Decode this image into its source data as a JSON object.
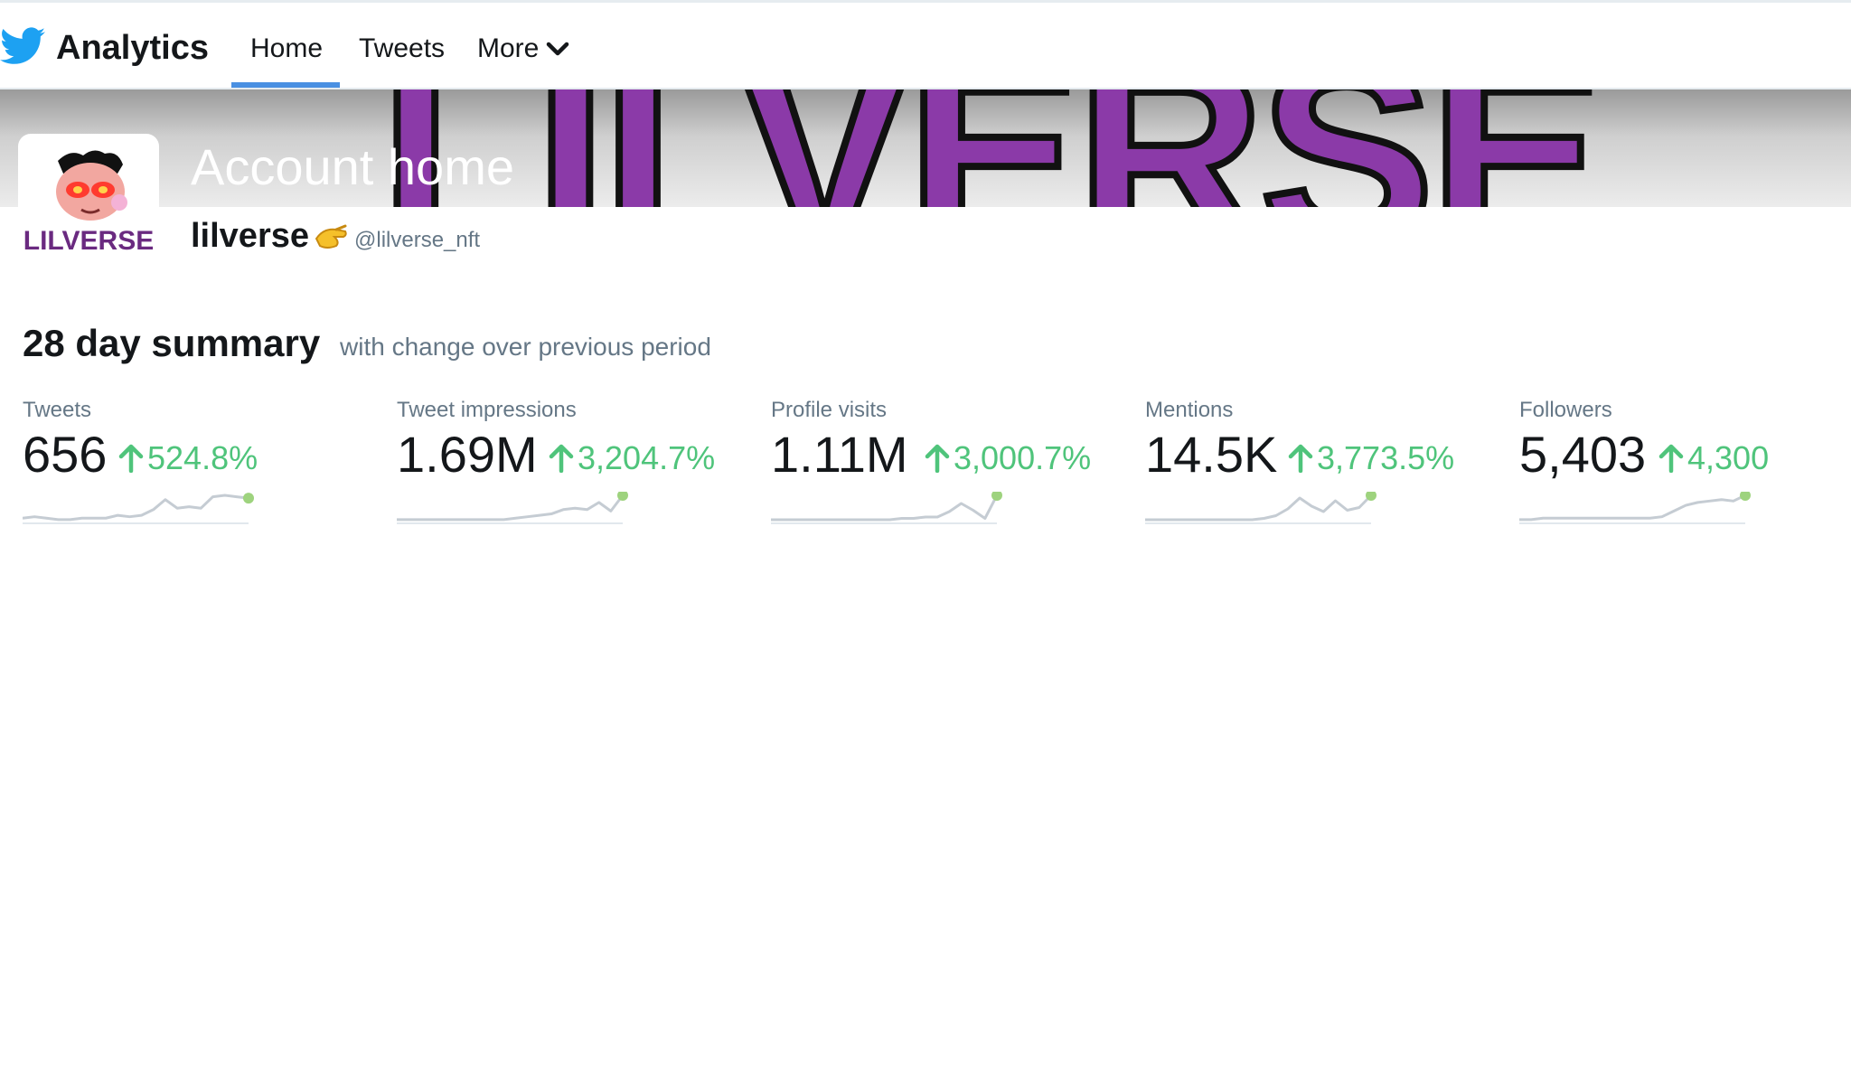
{
  "colors": {
    "accent": "#4a90e2",
    "positive": "#4fc47b",
    "spark_line": "#c5ccd3",
    "spark_dot": "#9ed37e",
    "banner_purple": "#8b3aa8"
  },
  "nav": {
    "brand_title": "Analytics",
    "items": [
      {
        "label": "Home",
        "active": true
      },
      {
        "label": "Tweets"
      },
      {
        "label": "More"
      }
    ]
  },
  "header": {
    "banner_text": "LILVERSE",
    "page_title": "Account home",
    "display_name": "lilverse",
    "badge_icon": "pinching-hand-emoji",
    "handle": "@lilverse_nft",
    "avatar_logo_text": "LILVERSE"
  },
  "summary": {
    "title": "28 day summary",
    "subtitle": "with change over previous period",
    "metrics": [
      {
        "label": "Tweets",
        "value": "656",
        "change": "524.8%",
        "trend": [
          3,
          4,
          3,
          2,
          2,
          3,
          3,
          3,
          5,
          4,
          5,
          9,
          16,
          10,
          11,
          10,
          18,
          19,
          18,
          17
        ]
      },
      {
        "label": "Tweet impressions",
        "value": "1.69M",
        "change": "3,204.7%",
        "trend": [
          2,
          2,
          2,
          2,
          2,
          2,
          2,
          2,
          2,
          2,
          3,
          4,
          5,
          6,
          9,
          10,
          9,
          14,
          8,
          19
        ]
      },
      {
        "label": "Profile visits",
        "value": "1.11M",
        "change": "3,000.7%",
        "trend": [
          2,
          2,
          2,
          2,
          2,
          2,
          2,
          2,
          2,
          2,
          2,
          3,
          3,
          4,
          4,
          8,
          14,
          9,
          3,
          20
        ]
      },
      {
        "label": "Mentions",
        "value": "14.5K",
        "change": "3,773.5%",
        "trend": [
          2,
          2,
          2,
          2,
          2,
          2,
          2,
          2,
          2,
          2,
          3,
          5,
          10,
          18,
          12,
          8,
          16,
          9,
          11,
          20
        ]
      },
      {
        "label": "Followers",
        "value": "5,403",
        "change": "4,300",
        "trend": [
          2,
          2,
          3,
          3,
          3,
          3,
          3,
          3,
          3,
          3,
          3,
          3,
          4,
          8,
          12,
          14,
          15,
          16,
          15,
          19
        ]
      }
    ]
  }
}
